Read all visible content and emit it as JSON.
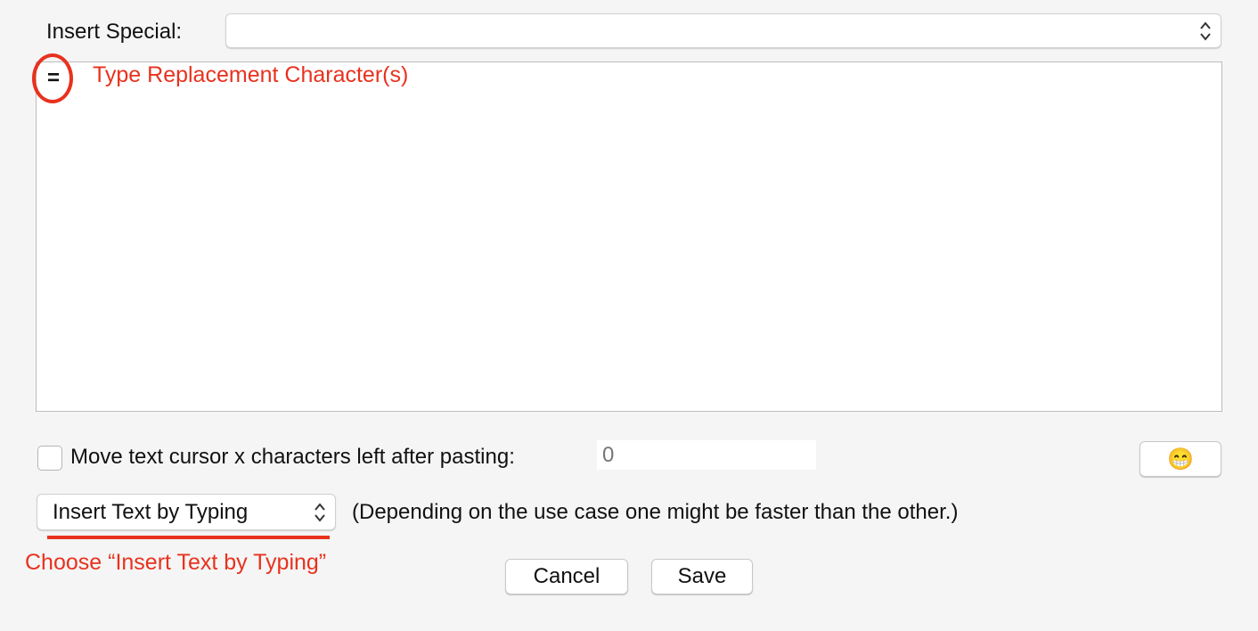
{
  "insert_special": {
    "label": "Insert Special:",
    "value": ""
  },
  "editor": {
    "content": "="
  },
  "annotations": {
    "type_replacement": "Type Replacement Character(s)",
    "choose_typing": "Choose “Insert Text by Typing”",
    "color": "#e8321e"
  },
  "cursor_option": {
    "label": "Move text cursor x characters left after pasting:",
    "checked": false,
    "value": "",
    "placeholder": "0"
  },
  "emoji_button": {
    "icon": "grimacing-face-icon",
    "glyph": "😁"
  },
  "insert_mode": {
    "selected": "Insert Text by Typing",
    "note": "(Depending on the use case one might be faster than the other.)"
  },
  "buttons": {
    "cancel": "Cancel",
    "save": "Save"
  }
}
